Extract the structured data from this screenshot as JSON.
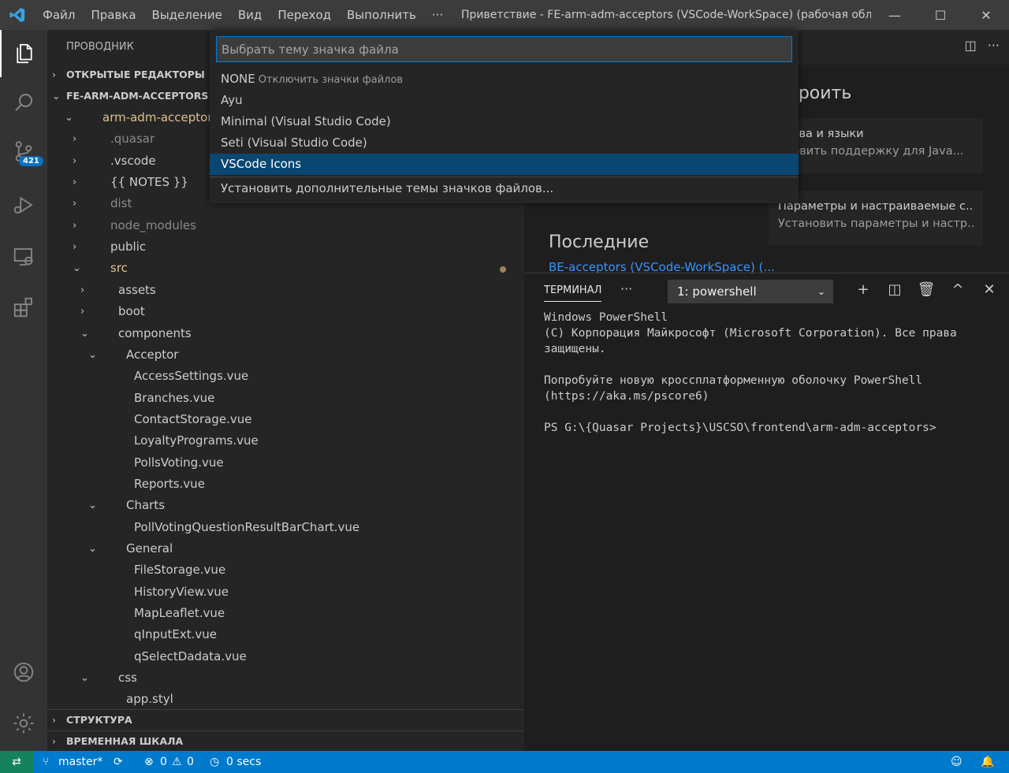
{
  "titlebar": {
    "menu": [
      "Файл",
      "Правка",
      "Выделение",
      "Вид",
      "Переход",
      "Выполнить",
      "···"
    ],
    "title": "Приветствие - FE-arm-adm-acceptors (VSCode-WorkSpace) (рабочая облас...",
    "min": "—",
    "max": "☐",
    "close": "✕"
  },
  "activitybar": {
    "scm_badge": "421"
  },
  "sidebar": {
    "header": "ПРОВОДНИК",
    "open_editors": "ОТКРЫТЫЕ РЕДАКТОРЫ",
    "workspace": "FE-ARM-ADM-ACCEPTORS (",
    "tree": [
      {
        "label": "arm-adm-acceptors",
        "indent": 0,
        "chev": "⌄",
        "style": "orange"
      },
      {
        "label": ".quasar",
        "indent": 1,
        "chev": "›",
        "style": "dim"
      },
      {
        "label": ".vscode",
        "indent": 1,
        "chev": "›",
        "style": ""
      },
      {
        "label": "{{ NOTES }}",
        "indent": 1,
        "chev": "›",
        "style": ""
      },
      {
        "label": "dist",
        "indent": 1,
        "chev": "›",
        "style": "dim"
      },
      {
        "label": "node_modules",
        "indent": 1,
        "chev": "›",
        "style": "dim"
      },
      {
        "label": "public",
        "indent": 1,
        "chev": "›",
        "style": ""
      },
      {
        "label": "src",
        "indent": 1,
        "chev": "⌄",
        "style": "orange"
      },
      {
        "label": "assets",
        "indent": 2,
        "chev": "›",
        "style": ""
      },
      {
        "label": "boot",
        "indent": 2,
        "chev": "›",
        "style": ""
      },
      {
        "label": "components",
        "indent": 2,
        "chev": "⌄",
        "style": ""
      },
      {
        "label": "Acceptor",
        "indent": 3,
        "chev": "⌄",
        "style": ""
      },
      {
        "label": "AccessSettings.vue",
        "indent": 4,
        "chev": "",
        "style": ""
      },
      {
        "label": "Branches.vue",
        "indent": 4,
        "chev": "",
        "style": ""
      },
      {
        "label": "ContactStorage.vue",
        "indent": 4,
        "chev": "",
        "style": ""
      },
      {
        "label": "LoyaltyPrograms.vue",
        "indent": 4,
        "chev": "",
        "style": ""
      },
      {
        "label": "PollsVoting.vue",
        "indent": 4,
        "chev": "",
        "style": ""
      },
      {
        "label": "Reports.vue",
        "indent": 4,
        "chev": "",
        "style": ""
      },
      {
        "label": "Charts",
        "indent": 3,
        "chev": "⌄",
        "style": ""
      },
      {
        "label": "PollVotingQuestionResultBarChart.vue",
        "indent": 4,
        "chev": "",
        "style": ""
      },
      {
        "label": "General",
        "indent": 3,
        "chev": "⌄",
        "style": ""
      },
      {
        "label": "FileStorage.vue",
        "indent": 4,
        "chev": "",
        "style": ""
      },
      {
        "label": "HistoryView.vue",
        "indent": 4,
        "chev": "",
        "style": ""
      },
      {
        "label": "MapLeaflet.vue",
        "indent": 4,
        "chev": "",
        "style": ""
      },
      {
        "label": "qInputExt.vue",
        "indent": 4,
        "chev": "",
        "style": ""
      },
      {
        "label": "qSelectDadata.vue",
        "indent": 4,
        "chev": "",
        "style": ""
      },
      {
        "label": "css",
        "indent": 2,
        "chev": "⌄",
        "style": ""
      },
      {
        "label": "app.styl",
        "indent": 3,
        "chev": "",
        "style": ""
      }
    ],
    "outline": "СТРУКТУРА",
    "timeline": "ВРЕМЕННАЯ ШКАЛА"
  },
  "welcome": {
    "customize_title": "троить",
    "card1_title": "дства и языки",
    "card1_desc": "ановить поддержку для Java...",
    "card2_title": "Параметры и настраиваемые с...",
    "card2_desc": "Установить параметры и настр...",
    "recent_title": "Последние",
    "recent_link": "BE-acceptors (VSCode-WorkSpace) (..."
  },
  "panel": {
    "tab": "ТЕРМИНАЛ",
    "more": "···",
    "selected_terminal": "1: powershell",
    "output": "Windows PowerShell\n(C) Корпорация Майкрософт (Microsoft Corporation). Все права защищены.\n\nПопробуйте новую кроссплатформенную оболочку PowerShell (https://aka.ms/pscore6)\n\nPS G:\\{Quasar Projects}\\USCSO\\frontend\\arm-adm-acceptors>"
  },
  "quickpick": {
    "placeholder": "Выбрать тему значка файла",
    "items": [
      {
        "label": "NONE",
        "desc": "Отключить значки файлов"
      },
      {
        "label": "Ayu",
        "desc": ""
      },
      {
        "label": "Minimal (Visual Studio Code)",
        "desc": ""
      },
      {
        "label": "Seti (Visual Studio Code)",
        "desc": ""
      },
      {
        "label": "VSCode Icons",
        "desc": ""
      }
    ],
    "install_more": "Установить дополнительные темы значков файлов..."
  },
  "statusbar": {
    "branch": "master*",
    "errors": "0",
    "warnings": "0",
    "time": "0 secs"
  },
  "colors": {
    "accent": "#007acc",
    "selection": "#094771",
    "badge": "#0e70c0"
  }
}
